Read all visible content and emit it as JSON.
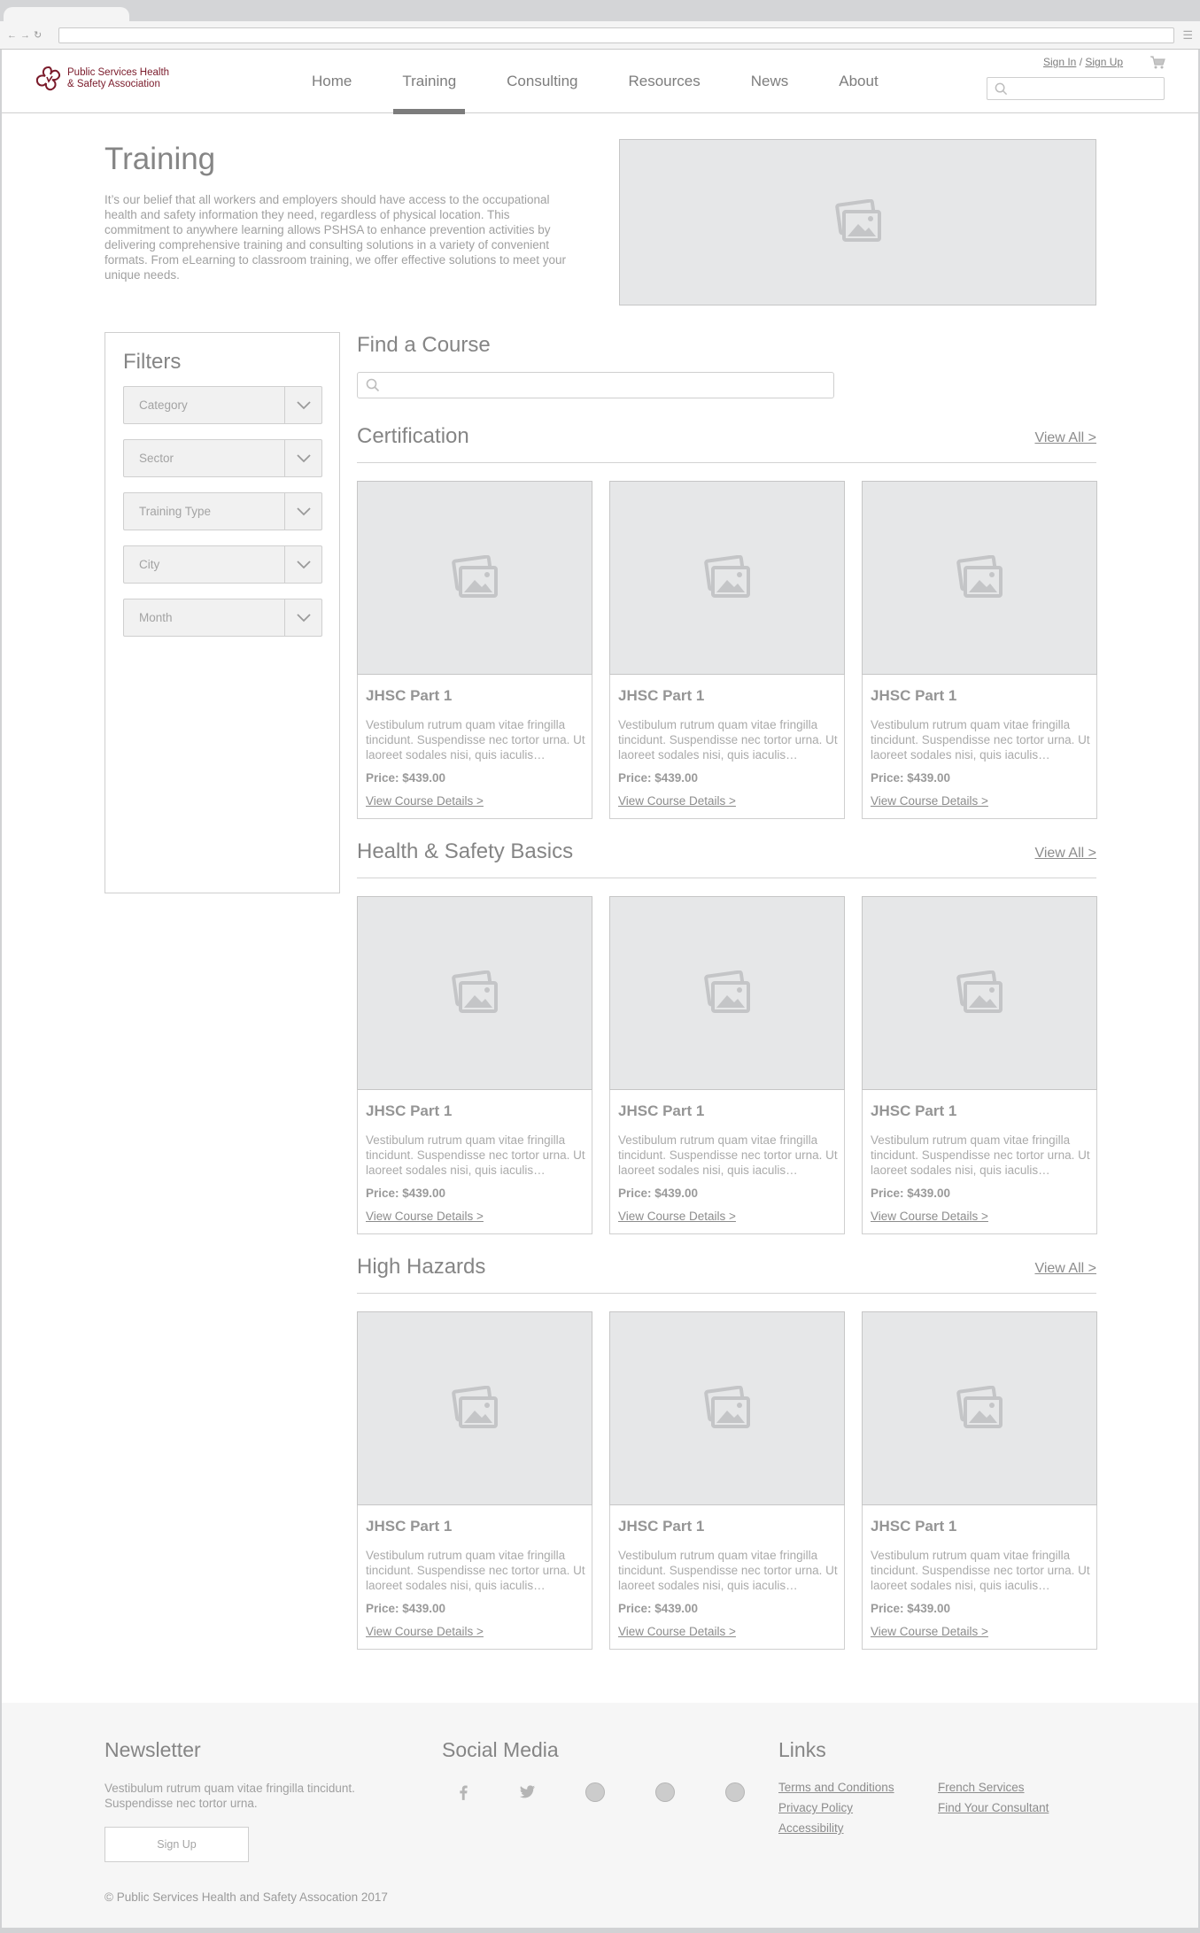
{
  "header": {
    "logo_line1": "Public Services Health",
    "logo_line2": "& Safety Association",
    "nav": [
      "Home",
      "Training",
      "Consulting",
      "Resources",
      "News",
      "About"
    ],
    "active_nav": "Training",
    "sign_in": "Sign In",
    "separator": "/",
    "sign_up": "Sign Up"
  },
  "hero": {
    "title": "Training",
    "text": "It’s our belief that all workers and employers should have access to the occupational health and safety information they need, regardless of physical location. This commitment to anywhere learning allows PSHSA to enhance prevention activities by delivering comprehensive training and consulting solutions in a variety of convenient formats. From eLearning to classroom training, we offer effective solutions to meet your unique needs."
  },
  "filters": {
    "title": "Filters",
    "selects": [
      "Category",
      "Sector",
      "Training Type",
      "City",
      "Month"
    ]
  },
  "find": {
    "title": "Find a Course"
  },
  "sections": [
    {
      "title": "Certification",
      "view_all": "View All >",
      "cards": [
        {
          "title": "JHSC Part 1",
          "desc": "Vestibulum rutrum quam vitae fringilla tincidunt. Suspendisse nec tortor urna. Ut laoreet sodales nisi, quis iaculis…",
          "price": "Price: $439.00",
          "link": "View Course Details >"
        },
        {
          "title": "JHSC Part 1",
          "desc": "Vestibulum rutrum quam vitae fringilla tincidunt. Suspendisse nec tortor urna. Ut laoreet sodales nisi, quis iaculis…",
          "price": "Price: $439.00",
          "link": "View Course Details >"
        },
        {
          "title": "JHSC Part 1",
          "desc": "Vestibulum rutrum quam vitae fringilla tincidunt. Suspendisse nec tortor urna. Ut laoreet sodales nisi, quis iaculis…",
          "price": "Price: $439.00",
          "link": "View Course Details >"
        }
      ]
    },
    {
      "title": "Health & Safety Basics",
      "view_all": "View All >",
      "cards": [
        {
          "title": "JHSC Part 1",
          "desc": "Vestibulum rutrum quam vitae fringilla tincidunt. Suspendisse nec tortor urna. Ut laoreet sodales nisi, quis iaculis…",
          "price": "Price: $439.00",
          "link": "View Course Details >"
        },
        {
          "title": "JHSC Part 1",
          "desc": "Vestibulum rutrum quam vitae fringilla tincidunt. Suspendisse nec tortor urna. Ut laoreet sodales nisi, quis iaculis…",
          "price": "Price: $439.00",
          "link": "View Course Details >"
        },
        {
          "title": "JHSC Part 1",
          "desc": "Vestibulum rutrum quam vitae fringilla tincidunt. Suspendisse nec tortor urna. Ut laoreet sodales nisi, quis iaculis…",
          "price": "Price: $439.00",
          "link": "View Course Details >"
        }
      ]
    },
    {
      "title": "High Hazards",
      "view_all": "View All >",
      "cards": [
        {
          "title": "JHSC Part 1",
          "desc": "Vestibulum rutrum quam vitae fringilla tincidunt. Suspendisse nec tortor urna. Ut laoreet sodales nisi, quis iaculis…",
          "price": "Price: $439.00",
          "link": "View Course Details >"
        },
        {
          "title": "JHSC Part 1",
          "desc": "Vestibulum rutrum quam vitae fringilla tincidunt. Suspendisse nec tortor urna. Ut laoreet sodales nisi, quis iaculis…",
          "price": "Price: $439.00",
          "link": "View Course Details >"
        },
        {
          "title": "JHSC Part 1",
          "desc": "Vestibulum rutrum quam vitae fringilla tincidunt. Suspendisse nec tortor urna. Ut laoreet sodales nisi, quis iaculis…",
          "price": "Price: $439.00",
          "link": "View Course Details >"
        }
      ]
    }
  ],
  "footer": {
    "newsletter_title": "Newsletter",
    "newsletter_text": "Vestibulum rutrum quam vitae fringilla tincidunt. Suspendisse nec tortor urna.",
    "signup_button": "Sign Up",
    "social_title": "Social Media",
    "social_icons": [
      "facebook-icon",
      "twitter-icon",
      "social-placeholder-icon",
      "social-placeholder-icon",
      "social-placeholder-icon"
    ],
    "links_title": "Links",
    "links_col1": [
      "Terms and Conditions",
      "Privacy Policy",
      "Accessibility"
    ],
    "links_col2": [
      "French Services",
      "Find Your Consultant"
    ],
    "copyright": "© Public Services Health and Safety Assocation 2017"
  }
}
